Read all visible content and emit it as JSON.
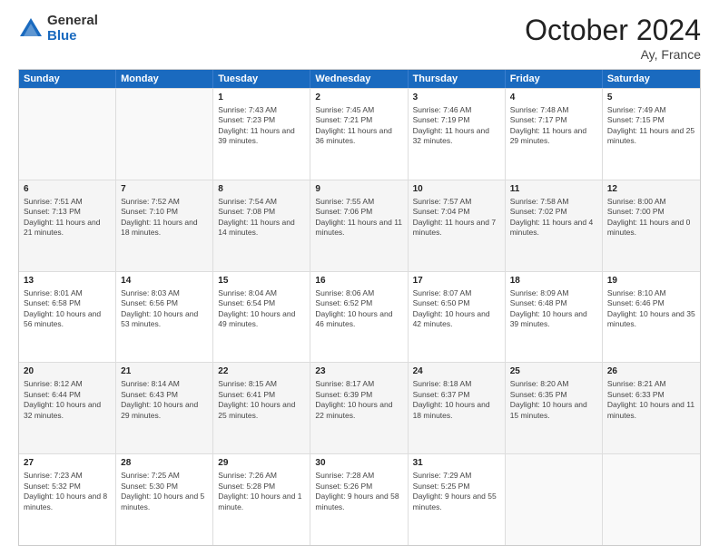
{
  "logo": {
    "general": "General",
    "blue": "Blue"
  },
  "title": "October 2024",
  "location": "Ay, France",
  "days_of_week": [
    "Sunday",
    "Monday",
    "Tuesday",
    "Wednesday",
    "Thursday",
    "Friday",
    "Saturday"
  ],
  "weeks": [
    [
      {
        "day": "",
        "empty": true
      },
      {
        "day": "",
        "empty": true
      },
      {
        "day": "1",
        "sunrise": "7:43 AM",
        "sunset": "7:23 PM",
        "daylight": "11 hours and 39 minutes."
      },
      {
        "day": "2",
        "sunrise": "7:45 AM",
        "sunset": "7:21 PM",
        "daylight": "11 hours and 36 minutes."
      },
      {
        "day": "3",
        "sunrise": "7:46 AM",
        "sunset": "7:19 PM",
        "daylight": "11 hours and 32 minutes."
      },
      {
        "day": "4",
        "sunrise": "7:48 AM",
        "sunset": "7:17 PM",
        "daylight": "11 hours and 29 minutes."
      },
      {
        "day": "5",
        "sunrise": "7:49 AM",
        "sunset": "7:15 PM",
        "daylight": "11 hours and 25 minutes."
      }
    ],
    [
      {
        "day": "6",
        "sunrise": "7:51 AM",
        "sunset": "7:13 PM",
        "daylight": "11 hours and 21 minutes."
      },
      {
        "day": "7",
        "sunrise": "7:52 AM",
        "sunset": "7:10 PM",
        "daylight": "11 hours and 18 minutes."
      },
      {
        "day": "8",
        "sunrise": "7:54 AM",
        "sunset": "7:08 PM",
        "daylight": "11 hours and 14 minutes."
      },
      {
        "day": "9",
        "sunrise": "7:55 AM",
        "sunset": "7:06 PM",
        "daylight": "11 hours and 11 minutes."
      },
      {
        "day": "10",
        "sunrise": "7:57 AM",
        "sunset": "7:04 PM",
        "daylight": "11 hours and 7 minutes."
      },
      {
        "day": "11",
        "sunrise": "7:58 AM",
        "sunset": "7:02 PM",
        "daylight": "11 hours and 4 minutes."
      },
      {
        "day": "12",
        "sunrise": "8:00 AM",
        "sunset": "7:00 PM",
        "daylight": "11 hours and 0 minutes."
      }
    ],
    [
      {
        "day": "13",
        "sunrise": "8:01 AM",
        "sunset": "6:58 PM",
        "daylight": "10 hours and 56 minutes."
      },
      {
        "day": "14",
        "sunrise": "8:03 AM",
        "sunset": "6:56 PM",
        "daylight": "10 hours and 53 minutes."
      },
      {
        "day": "15",
        "sunrise": "8:04 AM",
        "sunset": "6:54 PM",
        "daylight": "10 hours and 49 minutes."
      },
      {
        "day": "16",
        "sunrise": "8:06 AM",
        "sunset": "6:52 PM",
        "daylight": "10 hours and 46 minutes."
      },
      {
        "day": "17",
        "sunrise": "8:07 AM",
        "sunset": "6:50 PM",
        "daylight": "10 hours and 42 minutes."
      },
      {
        "day": "18",
        "sunrise": "8:09 AM",
        "sunset": "6:48 PM",
        "daylight": "10 hours and 39 minutes."
      },
      {
        "day": "19",
        "sunrise": "8:10 AM",
        "sunset": "6:46 PM",
        "daylight": "10 hours and 35 minutes."
      }
    ],
    [
      {
        "day": "20",
        "sunrise": "8:12 AM",
        "sunset": "6:44 PM",
        "daylight": "10 hours and 32 minutes."
      },
      {
        "day": "21",
        "sunrise": "8:14 AM",
        "sunset": "6:43 PM",
        "daylight": "10 hours and 29 minutes."
      },
      {
        "day": "22",
        "sunrise": "8:15 AM",
        "sunset": "6:41 PM",
        "daylight": "10 hours and 25 minutes."
      },
      {
        "day": "23",
        "sunrise": "8:17 AM",
        "sunset": "6:39 PM",
        "daylight": "10 hours and 22 minutes."
      },
      {
        "day": "24",
        "sunrise": "8:18 AM",
        "sunset": "6:37 PM",
        "daylight": "10 hours and 18 minutes."
      },
      {
        "day": "25",
        "sunrise": "8:20 AM",
        "sunset": "6:35 PM",
        "daylight": "10 hours and 15 minutes."
      },
      {
        "day": "26",
        "sunrise": "8:21 AM",
        "sunset": "6:33 PM",
        "daylight": "10 hours and 11 minutes."
      }
    ],
    [
      {
        "day": "27",
        "sunrise": "7:23 AM",
        "sunset": "5:32 PM",
        "daylight": "10 hours and 8 minutes."
      },
      {
        "day": "28",
        "sunrise": "7:25 AM",
        "sunset": "5:30 PM",
        "daylight": "10 hours and 5 minutes."
      },
      {
        "day": "29",
        "sunrise": "7:26 AM",
        "sunset": "5:28 PM",
        "daylight": "10 hours and 1 minute."
      },
      {
        "day": "30",
        "sunrise": "7:28 AM",
        "sunset": "5:26 PM",
        "daylight": "9 hours and 58 minutes."
      },
      {
        "day": "31",
        "sunrise": "7:29 AM",
        "sunset": "5:25 PM",
        "daylight": "9 hours and 55 minutes."
      },
      {
        "day": "",
        "empty": true
      },
      {
        "day": "",
        "empty": true
      }
    ]
  ]
}
